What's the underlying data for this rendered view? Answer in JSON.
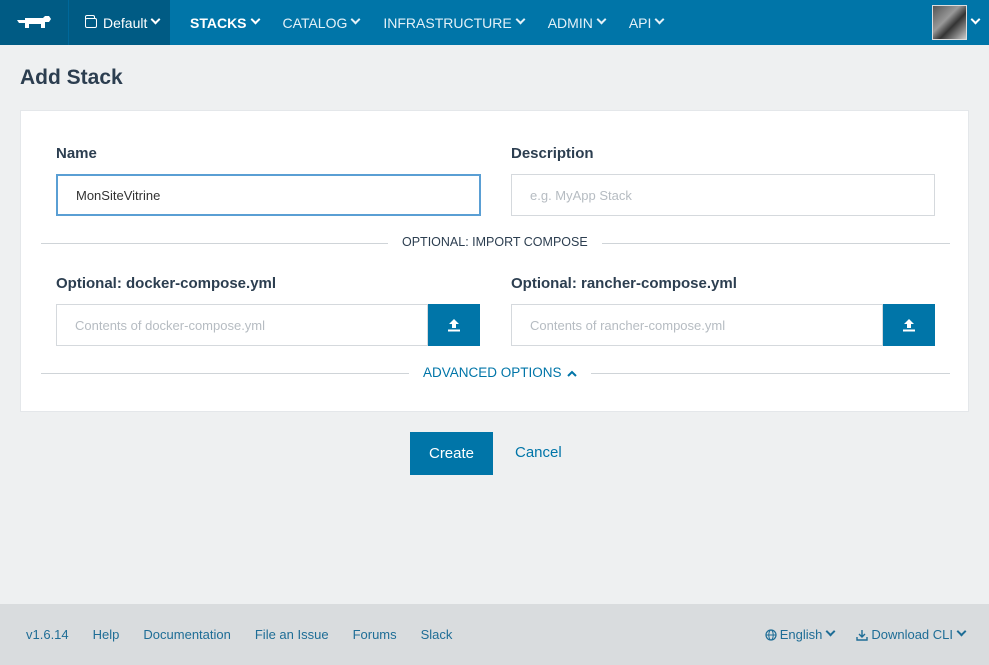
{
  "nav": {
    "environment": "Default",
    "items": [
      "STACKS",
      "CATALOG",
      "INFRASTRUCTURE",
      "ADMIN",
      "API"
    ]
  },
  "page": {
    "title": "Add Stack"
  },
  "form": {
    "name_label": "Name",
    "name_value": "MonSiteVitrine",
    "description_label": "Description",
    "description_placeholder": "e.g. MyApp Stack",
    "import_divider": "OPTIONAL: IMPORT COMPOSE",
    "docker_label": "Optional: docker-compose.yml",
    "docker_placeholder": "Contents of docker-compose.yml",
    "rancher_label": "Optional: rancher-compose.yml",
    "rancher_placeholder": "Contents of rancher-compose.yml",
    "advanced": "ADVANCED OPTIONS"
  },
  "actions": {
    "create": "Create",
    "cancel": "Cancel"
  },
  "footer": {
    "version": "v1.6.14",
    "links": [
      "Help",
      "Documentation",
      "File an Issue",
      "Forums",
      "Slack"
    ],
    "language": "English",
    "download": "Download CLI"
  },
  "colors": {
    "brand": "#0075a8",
    "brand_dark": "#005b84"
  }
}
